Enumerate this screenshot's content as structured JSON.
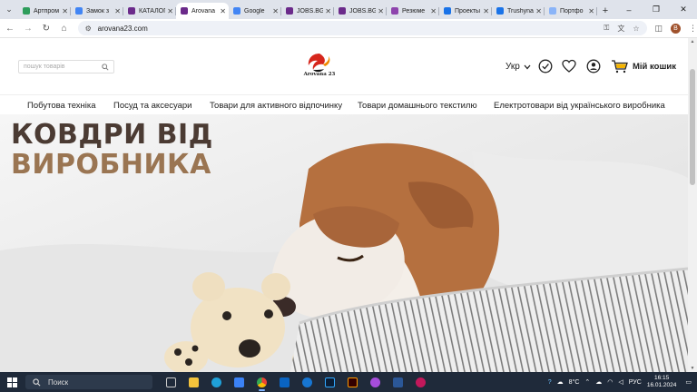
{
  "browser": {
    "tabs": [
      {
        "title": "Артпром",
        "color": "#2e9d5b",
        "active": false
      },
      {
        "title": "Замок з",
        "color": "#4285f4",
        "active": false
      },
      {
        "title": "КАТАЛОГ",
        "color": "#6b2a8a",
        "active": false
      },
      {
        "title": "Arovana",
        "color": "#6b2a8a",
        "active": true
      },
      {
        "title": "Google",
        "color": "#4285f4",
        "active": false
      },
      {
        "title": "JOBS.BG",
        "color": "#6b2a8a",
        "active": false
      },
      {
        "title": "JOBS.BG",
        "color": "#6b2a8a",
        "active": false
      },
      {
        "title": "Резюме",
        "color": "#8e44ad",
        "active": false
      },
      {
        "title": "Проекты",
        "color": "#1a73e8",
        "active": false
      },
      {
        "title": "Trushyna",
        "color": "#1a73e8",
        "active": false
      },
      {
        "title": "Портфо",
        "color": "#8ab4f8",
        "active": false
      }
    ],
    "url": "arovana23.com",
    "profile_initial": "B"
  },
  "site": {
    "search_placeholder": "пошук товарів",
    "logo_text": "Arovana 23",
    "language": "Укр",
    "cart_label": "Мій кошик",
    "accent_color": "#d6261c",
    "cart_color": "#f5b400"
  },
  "menu": [
    "Побутова техніка",
    "Посуд та аксесуари",
    "Товари для активного відпочинку",
    "Товари домашнього текстилю",
    "Електротовари від українського виробника"
  ],
  "hero": {
    "line1": "КОВДРИ ВІД",
    "line2": "ВИРОБНИКА"
  },
  "taskbar": {
    "search_label": "Поиск",
    "weather": "8°C",
    "language": "РУС",
    "time": "16:15",
    "date": "16.01.2024"
  }
}
